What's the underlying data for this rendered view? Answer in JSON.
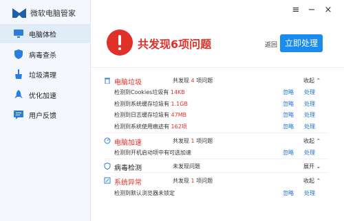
{
  "app": {
    "title": "微软电脑管家"
  },
  "window_controls": {
    "menu": "≡",
    "minimize": "−",
    "close": "×"
  },
  "sidebar": {
    "items": [
      {
        "label": "电脑体检",
        "icon": "monitor-icon",
        "active": true
      },
      {
        "label": "病毒查杀",
        "icon": "shield-icon",
        "active": false
      },
      {
        "label": "垃圾清理",
        "icon": "broom-icon",
        "active": false
      },
      {
        "label": "优化加速",
        "icon": "rocket-icon",
        "active": false
      },
      {
        "label": "用户反馈",
        "icon": "feedback-icon",
        "active": false
      }
    ]
  },
  "header": {
    "headline": "共发现6项问题",
    "back_label": "返回",
    "action_label": "立即处理"
  },
  "labels": {
    "ignore": "忽略",
    "handle": "处理"
  },
  "sections": [
    {
      "title": "电脑垃圾",
      "title_color": "#e0302a",
      "icon": "trash-icon",
      "status_prefix": "共发现",
      "status_count": "4",
      "status_suffix": "项问题",
      "toggle": "收起 ⌃",
      "rows": [
        {
          "prefix": "检测到Cookies垃圾有 ",
          "value": "14KB",
          "suffix": ""
        },
        {
          "prefix": "检测到系统缓存垃圾有 ",
          "value": "1.1GB",
          "suffix": ""
        },
        {
          "prefix": "检测到日志缓存垃圾有 ",
          "value": "47MB",
          "suffix": ""
        },
        {
          "prefix": "检测到系统使用痕迹有 ",
          "value": "162项",
          "suffix": ""
        }
      ]
    },
    {
      "title": "电脑加速",
      "title_color": "#e0302a",
      "icon": "speed-icon",
      "status_prefix": "共发现",
      "status_count": "1",
      "status_suffix": "项问题",
      "toggle": "收起 ⌃",
      "rows": [
        {
          "prefix": "检测到开机启动项中有可选加速",
          "value": "",
          "suffix": ""
        }
      ]
    },
    {
      "title": "病毒检测",
      "title_color": "#222222",
      "icon": "shield-check-icon",
      "status_prefix": "未发现问题",
      "status_count": "",
      "status_suffix": "",
      "toggle": "展开 ⌄",
      "rows": []
    },
    {
      "title": "系统异常",
      "title_color": "#e0302a",
      "icon": "system-icon",
      "status_prefix": "共发现",
      "status_count": "1",
      "status_suffix": "项问题",
      "toggle": "收起 ⌃",
      "rows": [
        {
          "prefix": "检测到默认浏览器未锁定",
          "value": "",
          "suffix": ""
        }
      ]
    }
  ],
  "colors": {
    "accent": "#1a8cf0",
    "danger": "#e0302a",
    "link": "#1a6fd8",
    "sidebar_bg": "#f4f8fd"
  }
}
